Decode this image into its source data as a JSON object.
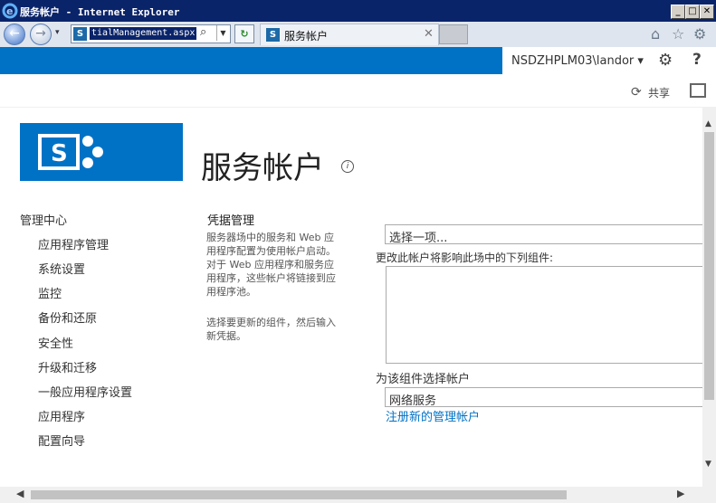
{
  "window": {
    "title": "服务帐户 - Internet Explorer",
    "min_glyph": "_",
    "max_glyph": "□",
    "close_glyph": "✕"
  },
  "browser": {
    "url": "tialManagement.aspx",
    "tab_title": "服务帐户",
    "tab_close": "✕",
    "sp_glyph": "S",
    "search_glyph": "⌕",
    "dropdown_glyph": "▼",
    "back_glyph": "←",
    "forward_glyph": "→",
    "refresh_glyph": "↻",
    "home_glyph": "⌂",
    "favorites_glyph": "☆",
    "tools_glyph": "⚙",
    "history_glyph": "▾"
  },
  "suite": {
    "user": "NSDZHPLM03\\landor ▾",
    "gear_glyph": "⚙",
    "help_glyph": "?",
    "share_glyph": "⟳",
    "share_label": "共享",
    "accent": "#0072c6"
  },
  "page": {
    "title": "服务帐户",
    "info_glyph": "i"
  },
  "nav": {
    "heading": "管理中心",
    "items": [
      "应用程序管理",
      "系统设置",
      "监控",
      "备份和还原",
      "安全性",
      "升级和迁移",
      "一般应用程序设置",
      "应用程序",
      "配置向导"
    ]
  },
  "section": {
    "title": "凭据管理",
    "desc1": [
      "服务器场中的服务和 Web 应",
      "用程序配置为使用帐户启动。",
      "对于 Web 应用程序和服务应",
      "用程序，这些帐户将链接到应",
      "用程序池。"
    ],
    "desc2": [
      "选择要更新的组件，然后输入",
      "新凭据。"
    ]
  },
  "form": {
    "select_component": "选择一项...",
    "components_label": "更改此帐户将影响此场中的下列组件:",
    "account_label": "为该组件选择帐户",
    "account_value": "网络服务",
    "register_link": "注册新的管理帐户"
  },
  "scroll": {
    "up": "▲",
    "down": "▼",
    "left": "◀",
    "right": "▶"
  }
}
